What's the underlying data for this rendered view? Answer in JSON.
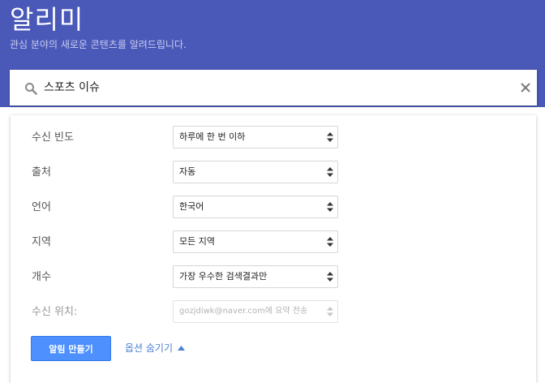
{
  "header": {
    "title": "알리미",
    "subtitle": "관심 분야의 새로운 콘텐츠를 알려드립니다.",
    "background_color": "#4a58b8"
  },
  "search": {
    "value": "스포츠 이슈",
    "search_icon": "search-icon",
    "clear_icon": "close-icon"
  },
  "options": {
    "frequency": {
      "label": "수신 빈도",
      "value": "하루에 한 번 이하"
    },
    "sources": {
      "label": "출처",
      "value": "자동"
    },
    "language": {
      "label": "언어",
      "value": "한국어"
    },
    "region": {
      "label": "지역",
      "value": "모든 지역"
    },
    "count": {
      "label": "개수",
      "value": "가장 우수한 검색결과만"
    },
    "deliver_to": {
      "label": "수신 위치:",
      "value": "gozjdiwk@naver.com에 요약 전송"
    },
    "select_icon": "sort-arrows-icon"
  },
  "actions": {
    "create_label": "알림 만들기",
    "hide_options_label": "옵션 숨기기",
    "accent_color": "#4d90fe",
    "link_color": "#4a7fd6"
  }
}
